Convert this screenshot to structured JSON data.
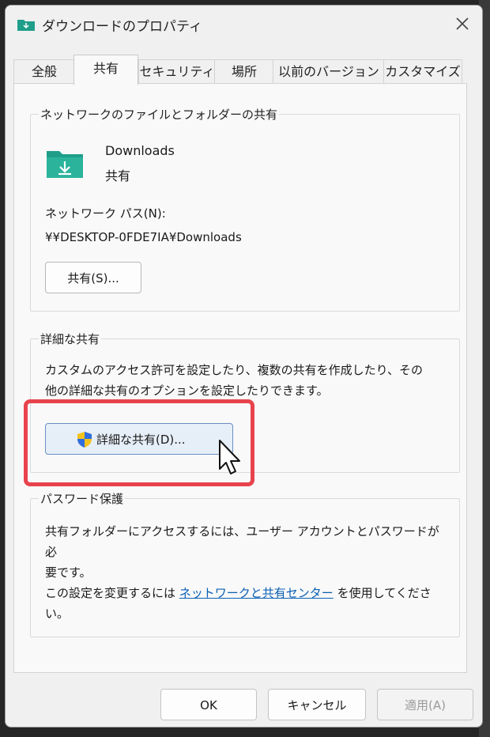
{
  "window": {
    "title": "ダウンロードのプロパティ"
  },
  "tabs": [
    {
      "label": "全般"
    },
    {
      "label": "共有"
    },
    {
      "label": "セキュリティ"
    },
    {
      "label": "場所"
    },
    {
      "label": "以前のバージョン"
    },
    {
      "label": "カスタマイズ"
    }
  ],
  "network_sharing": {
    "group_label": "ネットワークのファイルとフォルダーの共有",
    "folder_name": "Downloads",
    "folder_status": "共有",
    "network_path_label": "ネットワーク パス(N):",
    "network_path_value": "¥¥DESKTOP-0FDE7IA¥Downloads",
    "share_button": "共有(S)..."
  },
  "advanced_sharing": {
    "group_label": "詳細な共有",
    "description_line1": "カスタムのアクセス許可を設定したり、複数の共有を作成したり、その",
    "description_line2": "他の詳細な共有のオプションを設定したりできます。",
    "button": "詳細な共有(D)..."
  },
  "password_protection": {
    "group_label": "パスワード保護",
    "text_line1": "共有フォルダーにアクセスするには、ユーザー アカウントとパスワードが必",
    "text_line2": "要です。",
    "change_prefix": "この設定を変更するには",
    "link": "ネットワークと共有センター",
    "change_suffix": "を使用してくださ",
    "change_line2": "い。"
  },
  "footer": {
    "ok": "OK",
    "cancel": "キャンセル",
    "apply": "適用(A)"
  },
  "colors": {
    "highlight": "#e8434d",
    "folder": "#1f9e8a",
    "link": "#0a5fb4"
  }
}
